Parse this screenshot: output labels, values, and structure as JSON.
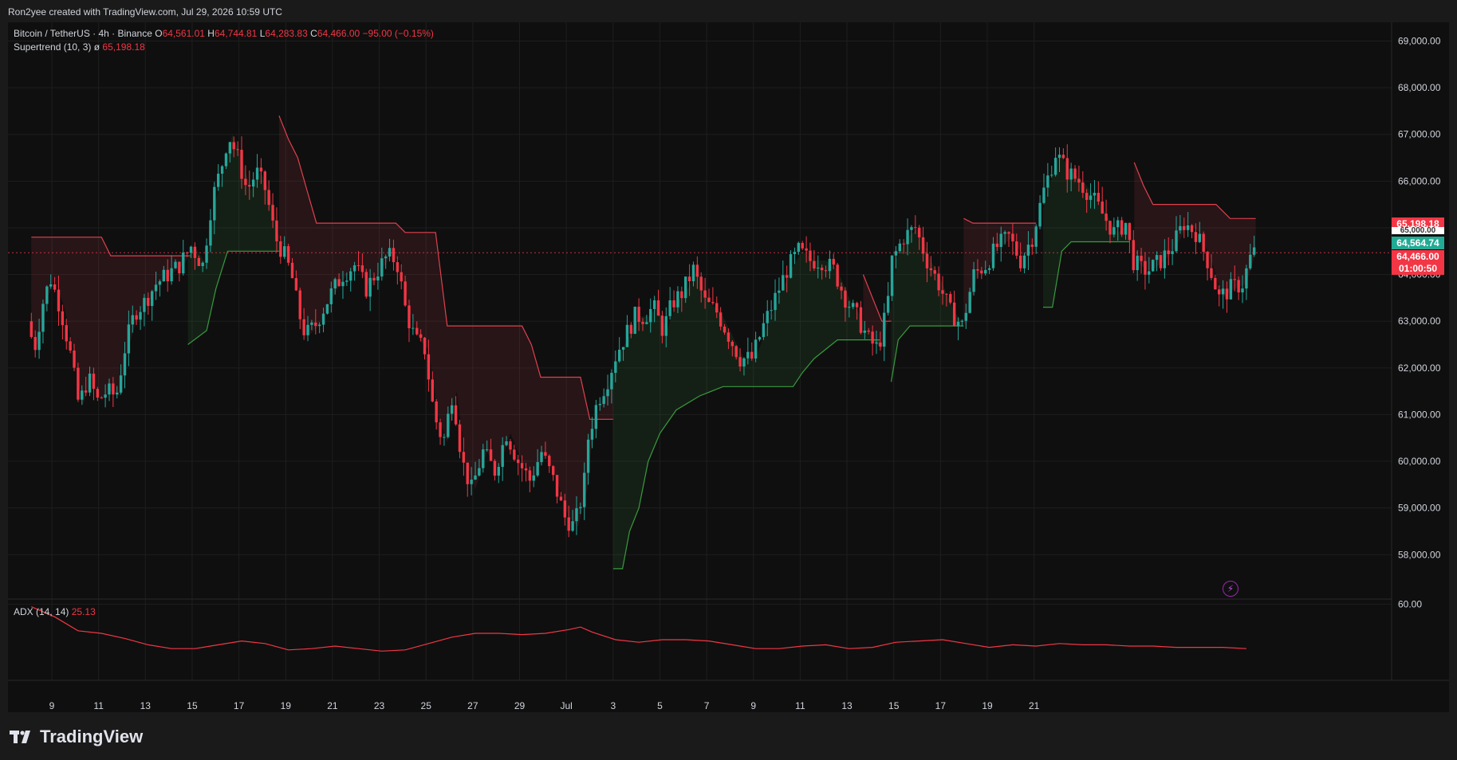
{
  "header": {
    "attribution": "Ron2yee created with TradingView.com, Jul 29, 2026 10:59 UTC"
  },
  "legend": {
    "symbol": "Bitcoin / TetherUS · 4h · Binance",
    "open_label": "O",
    "open": "64,561.01",
    "high_label": "H",
    "high": "64,744.81",
    "low_label": "L",
    "low": "64,283.83",
    "close_label": "C",
    "close": "64,466.00",
    "change": "−95.00 (−0.15%)",
    "supertrend_name": "Supertrend (10, 3)",
    "supertrend_icon": "hidden-eye-icon",
    "supertrend_value": "65,198.18",
    "adx_name": "ADX (14, 14)",
    "adx_value": "25.13"
  },
  "price_tags": {
    "supertrend": "65,198.18",
    "upper_partial": "65,000.00",
    "green": "64,564.74",
    "last": "64,466.00",
    "countdown": "01:00:50"
  },
  "brand": {
    "name": "TradingView",
    "icon": "tradingview-logo-icon"
  },
  "colors": {
    "up": "#26a69a",
    "down": "#f23645",
    "supertrend_up": "#3a9a3e",
    "supertrend_down": "#e0404f",
    "adx_line": "#f23645",
    "background": "#0f0f0f",
    "grid": "#1e1e1e"
  },
  "chart_data": [
    {
      "type": "candlestick",
      "title": "Bitcoin / TetherUS · 4h · Binance",
      "x_ticks": [
        "9",
        "11",
        "13",
        "15",
        "17",
        "19",
        "21",
        "23",
        "25",
        "27",
        "29",
        "Jul",
        "3",
        "5",
        "7",
        "9",
        "11",
        "13",
        "15",
        "17",
        "19",
        "21"
      ],
      "y_ticks": [
        58000,
        59000,
        60000,
        61000,
        62000,
        63000,
        64000,
        65000,
        66000,
        67000,
        68000,
        69000
      ],
      "ylim": [
        57050,
        69400
      ],
      "last_price": 64466.0,
      "grid": true,
      "axis_position": "right",
      "price_path": [
        {
          "day": 7.0,
          "price": 63000
        },
        {
          "day": 7.3,
          "price": 62400
        },
        {
          "day": 7.7,
          "price": 63500
        },
        {
          "day": 8.0,
          "price": 63900
        },
        {
          "day": 8.4,
          "price": 63300
        },
        {
          "day": 8.8,
          "price": 62400
        },
        {
          "day": 9.2,
          "price": 61200
        },
        {
          "day": 9.6,
          "price": 61800
        },
        {
          "day": 10.0,
          "price": 61300
        },
        {
          "day": 10.4,
          "price": 61500
        },
        {
          "day": 10.8,
          "price": 61400
        },
        {
          "day": 11.2,
          "price": 62500
        },
        {
          "day": 11.6,
          "price": 63200
        },
        {
          "day": 12.0,
          "price": 63400
        },
        {
          "day": 12.5,
          "price": 63800
        },
        {
          "day": 13.0,
          "price": 64000
        },
        {
          "day": 13.5,
          "price": 64200
        },
        {
          "day": 14.0,
          "price": 64600
        },
        {
          "day": 14.5,
          "price": 64200
        },
        {
          "day": 14.9,
          "price": 65600
        },
        {
          "day": 15.3,
          "price": 66300
        },
        {
          "day": 15.6,
          "price": 67000
        },
        {
          "day": 16.0,
          "price": 66500
        },
        {
          "day": 16.4,
          "price": 65800
        },
        {
          "day": 16.8,
          "price": 66200
        },
        {
          "day": 17.2,
          "price": 65800
        },
        {
          "day": 17.6,
          "price": 64800
        },
        {
          "day": 18.0,
          "price": 64400
        },
        {
          "day": 18.3,
          "price": 64000
        },
        {
          "day": 18.6,
          "price": 63200
        },
        {
          "day": 18.9,
          "price": 62700
        },
        {
          "day": 19.3,
          "price": 62900
        },
        {
          "day": 19.7,
          "price": 63300
        },
        {
          "day": 20.0,
          "price": 63600
        },
        {
          "day": 20.5,
          "price": 64000
        },
        {
          "day": 21.0,
          "price": 64200
        },
        {
          "day": 21.5,
          "price": 63700
        },
        {
          "day": 22.0,
          "price": 64100
        },
        {
          "day": 22.4,
          "price": 64400
        },
        {
          "day": 22.8,
          "price": 64300
        },
        {
          "day": 23.2,
          "price": 63200
        },
        {
          "day": 23.6,
          "price": 62600
        },
        {
          "day": 24.0,
          "price": 62400
        },
        {
          "day": 24.4,
          "price": 61000
        },
        {
          "day": 24.8,
          "price": 60400
        },
        {
          "day": 25.2,
          "price": 61500
        },
        {
          "day": 25.6,
          "price": 60000
        },
        {
          "day": 26.0,
          "price": 59400
        },
        {
          "day": 26.5,
          "price": 60200
        },
        {
          "day": 27.0,
          "price": 59800
        },
        {
          "day": 27.5,
          "price": 60600
        },
        {
          "day": 28.0,
          "price": 60000
        },
        {
          "day": 28.5,
          "price": 59600
        },
        {
          "day": 29.0,
          "price": 60200
        },
        {
          "day": 29.5,
          "price": 59600
        },
        {
          "day": 30.0,
          "price": 58800
        },
        {
          "day": 30.4,
          "price": 58600
        },
        {
          "day": 30.8,
          "price": 59400
        },
        {
          "day": 31.0,
          "price": 60500
        },
        {
          "day": 31.4,
          "price": 61300
        },
        {
          "day": 31.8,
          "price": 61700
        },
        {
          "day": 32.2,
          "price": 62300
        },
        {
          "day": 32.6,
          "price": 62700
        },
        {
          "day": 33.0,
          "price": 63100
        },
        {
          "day": 33.4,
          "price": 63100
        },
        {
          "day": 33.8,
          "price": 63300
        },
        {
          "day": 34.2,
          "price": 62800
        },
        {
          "day": 34.6,
          "price": 63400
        },
        {
          "day": 35.0,
          "price": 63600
        },
        {
          "day": 35.5,
          "price": 64100
        },
        {
          "day": 36.0,
          "price": 63400
        },
        {
          "day": 36.5,
          "price": 63200
        },
        {
          "day": 37.0,
          "price": 62700
        },
        {
          "day": 37.5,
          "price": 62200
        },
        {
          "day": 38.0,
          "price": 62200
        },
        {
          "day": 38.5,
          "price": 62900
        },
        {
          "day": 39.0,
          "price": 63500
        },
        {
          "day": 39.5,
          "price": 64100
        },
        {
          "day": 40.0,
          "price": 64500
        },
        {
          "day": 40.5,
          "price": 64300
        },
        {
          "day": 41.0,
          "price": 64300
        },
        {
          "day": 41.5,
          "price": 64100
        },
        {
          "day": 42.0,
          "price": 63500
        },
        {
          "day": 42.5,
          "price": 63100
        },
        {
          "day": 43.0,
          "price": 62600
        },
        {
          "day": 43.4,
          "price": 62400
        },
        {
          "day": 43.8,
          "price": 63300
        },
        {
          "day": 44.0,
          "price": 64300
        },
        {
          "day": 44.5,
          "price": 64800
        },
        {
          "day": 45.0,
          "price": 65000
        },
        {
          "day": 45.5,
          "price": 64300
        },
        {
          "day": 46.0,
          "price": 63800
        },
        {
          "day": 46.5,
          "price": 63200
        },
        {
          "day": 47.0,
          "price": 62900
        },
        {
          "day": 47.5,
          "price": 64000
        },
        {
          "day": 48.0,
          "price": 64200
        },
        {
          "day": 48.5,
          "price": 64600
        },
        {
          "day": 49.0,
          "price": 64800
        },
        {
          "day": 49.5,
          "price": 64300
        },
        {
          "day": 50.0,
          "price": 64800
        },
        {
          "day": 50.5,
          "price": 65800
        },
        {
          "day": 51.0,
          "price": 66600
        },
        {
          "day": 51.5,
          "price": 66200
        },
        {
          "day": 52.0,
          "price": 66000
        },
        {
          "day": 52.5,
          "price": 65700
        },
        {
          "day": 53.0,
          "price": 65300
        },
        {
          "day": 53.5,
          "price": 64900
        },
        {
          "day": 54.0,
          "price": 65100
        },
        {
          "day": 54.3,
          "price": 64300
        },
        {
          "day": 54.7,
          "price": 64100
        },
        {
          "day": 55.0,
          "price": 64100
        },
        {
          "day": 55.5,
          "price": 64300
        },
        {
          "day": 56.0,
          "price": 64600
        },
        {
          "day": 56.5,
          "price": 65100
        },
        {
          "day": 57.0,
          "price": 64900
        },
        {
          "day": 57.5,
          "price": 64300
        },
        {
          "day": 58.0,
          "price": 63500
        },
        {
          "day": 58.5,
          "price": 63700
        },
        {
          "day": 59.0,
          "price": 63800
        },
        {
          "day": 59.4,
          "price": 64466
        }
      ],
      "supertrend": [
        {
          "trend": "down",
          "points": [
            {
              "day": 7.0,
              "price": 64800
            },
            {
              "day": 10.0,
              "price": 64800
            },
            {
              "day": 10.4,
              "price": 64400
            },
            {
              "day": 13.8,
              "price": 64400
            }
          ]
        },
        {
          "trend": "up",
          "points": [
            {
              "day": 13.7,
              "price": 62500
            },
            {
              "day": 14.5,
              "price": 62800
            },
            {
              "day": 14.9,
              "price": 63700
            },
            {
              "day": 15.4,
              "price": 64500
            },
            {
              "day": 17.6,
              "price": 64500
            }
          ]
        },
        {
          "trend": "down",
          "points": [
            {
              "day": 17.6,
              "price": 67400
            },
            {
              "day": 18.0,
              "price": 66900
            },
            {
              "day": 18.4,
              "price": 66500
            },
            {
              "day": 18.8,
              "price": 65800
            },
            {
              "day": 19.2,
              "price": 65100
            },
            {
              "day": 22.6,
              "price": 65100
            },
            {
              "day": 23.0,
              "price": 64900
            },
            {
              "day": 24.3,
              "price": 64900
            },
            {
              "day": 24.8,
              "price": 62900
            },
            {
              "day": 28.0,
              "price": 62900
            },
            {
              "day": 28.4,
              "price": 62500
            },
            {
              "day": 28.8,
              "price": 61800
            },
            {
              "day": 30.5,
              "price": 61800
            },
            {
              "day": 30.9,
              "price": 60900
            },
            {
              "day": 31.9,
              "price": 60900
            }
          ]
        },
        {
          "trend": "up",
          "points": [
            {
              "day": 31.9,
              "price": 57700
            },
            {
              "day": 32.3,
              "price": 57700
            },
            {
              "day": 32.6,
              "price": 58500
            },
            {
              "day": 33.0,
              "price": 59000
            },
            {
              "day": 33.4,
              "price": 60000
            },
            {
              "day": 33.9,
              "price": 60600
            },
            {
              "day": 34.6,
              "price": 61100
            },
            {
              "day": 35.6,
              "price": 61400
            },
            {
              "day": 36.6,
              "price": 61600
            },
            {
              "day": 39.6,
              "price": 61600
            },
            {
              "day": 40.0,
              "price": 61900
            },
            {
              "day": 40.5,
              "price": 62200
            },
            {
              "day": 41.0,
              "price": 62400
            },
            {
              "day": 41.5,
              "price": 62600
            },
            {
              "day": 43.3,
              "price": 62600
            }
          ]
        },
        {
          "trend": "down",
          "points": [
            {
              "day": 42.6,
              "price": 64000
            },
            {
              "day": 43.4,
              "price": 63000
            },
            {
              "day": 43.8,
              "price": 63000
            }
          ]
        },
        {
          "trend": "up",
          "points": [
            {
              "day": 43.8,
              "price": 61700
            },
            {
              "day": 44.1,
              "price": 62600
            },
            {
              "day": 44.6,
              "price": 62900
            },
            {
              "day": 46.9,
              "price": 62900
            }
          ]
        },
        {
          "trend": "down",
          "points": [
            {
              "day": 46.9,
              "price": 65200
            },
            {
              "day": 47.3,
              "price": 65100
            },
            {
              "day": 50.0,
              "price": 65100
            }
          ]
        },
        {
          "trend": "up",
          "points": [
            {
              "day": 50.3,
              "price": 63300
            },
            {
              "day": 50.7,
              "price": 63300
            },
            {
              "day": 51.1,
              "price": 64500
            },
            {
              "day": 51.5,
              "price": 64700
            },
            {
              "day": 54.0,
              "price": 64700
            }
          ]
        },
        {
          "trend": "down",
          "points": [
            {
              "day": 54.2,
              "price": 66400
            },
            {
              "day": 54.6,
              "price": 65900
            },
            {
              "day": 55.0,
              "price": 65500
            },
            {
              "day": 57.7,
              "price": 65500
            },
            {
              "day": 58.3,
              "price": 65200
            },
            {
              "day": 59.4,
              "price": 65198
            }
          ]
        }
      ]
    },
    {
      "type": "line",
      "title": "ADX (14, 14)",
      "y_ticks": [
        60
      ],
      "ylim": [
        0,
        64
      ],
      "last_value": 25.13,
      "x_days": [
        7,
        8,
        9,
        10,
        11,
        12,
        13,
        14,
        15,
        16,
        17,
        18,
        19,
        20,
        21,
        22,
        23,
        24,
        25,
        26,
        27,
        28,
        29,
        30,
        30.5,
        31,
        32,
        33,
        34,
        35,
        36,
        37,
        38,
        39,
        40,
        41,
        42,
        43,
        44,
        45,
        46,
        47,
        48,
        49,
        50,
        51,
        52,
        53,
        54,
        55,
        56,
        57,
        58,
        59
      ],
      "values": [
        58,
        50,
        39,
        37,
        33,
        28,
        25,
        25,
        28,
        31,
        29,
        24,
        25,
        27,
        25,
        23,
        24,
        29,
        34,
        37,
        37,
        36,
        37,
        40,
        42,
        38,
        32,
        30,
        32,
        32,
        31,
        28,
        25,
        25,
        27,
        28,
        25,
        26,
        30,
        31,
        32,
        29,
        26,
        28,
        27,
        29,
        28,
        28,
        27,
        27,
        26,
        26,
        26,
        25
      ]
    }
  ]
}
